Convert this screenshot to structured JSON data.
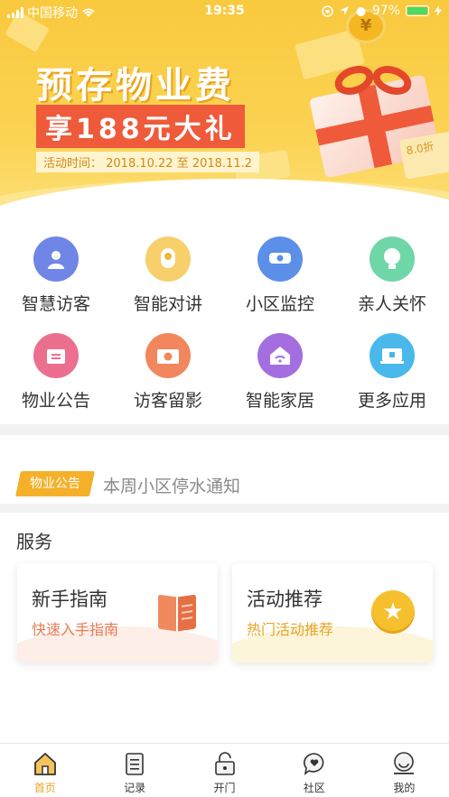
{
  "status_bar": {
    "carrier": "中国移动",
    "time": "19:35",
    "battery": "97%"
  },
  "banner": {
    "title": "预存物业费",
    "subtitle": "享188元大礼",
    "dates": "活动时间：  2018.10.22  至  2018.11.2",
    "coin_symbol": "¥",
    "tag_text": "8.0折"
  },
  "grid": [
    {
      "label": "智慧访客",
      "icon": "visitor-icon",
      "color": "#6f86e6"
    },
    {
      "label": "智能对讲",
      "icon": "intercom-icon",
      "color": "#f7cf6b"
    },
    {
      "label": "小区监控",
      "icon": "camera-icon",
      "color": "#5b8fe8"
    },
    {
      "label": "亲人关怀",
      "icon": "bulb-icon",
      "color": "#6fd6a8"
    },
    {
      "label": "物业公告",
      "icon": "notice-icon",
      "color": "#ec6f90"
    },
    {
      "label": "访客留影",
      "icon": "photo-icon",
      "color": "#f2865c"
    },
    {
      "label": "智能家居",
      "icon": "smart-home-icon",
      "color": "#a46ee0"
    },
    {
      "label": "更多应用",
      "icon": "more-apps-icon",
      "color": "#4ab8ea"
    }
  ],
  "notice": {
    "badge": "物业公告",
    "text": "本周小区停水通知"
  },
  "services": {
    "title": "服务",
    "cards": [
      {
        "title": "新手指南",
        "subtitle": "快速入手指南",
        "accent": "#e87c56"
      },
      {
        "title": "活动推荐",
        "subtitle": "热门活动推荐",
        "accent": "#e6a625"
      }
    ]
  },
  "tabbar": [
    {
      "label": "首页",
      "icon": "home-icon",
      "active": true
    },
    {
      "label": "记录",
      "icon": "records-icon",
      "active": false
    },
    {
      "label": "开门",
      "icon": "unlock-icon",
      "active": false
    },
    {
      "label": "社区",
      "icon": "community-icon",
      "active": false
    },
    {
      "label": "我的",
      "icon": "profile-icon",
      "active": false
    }
  ]
}
